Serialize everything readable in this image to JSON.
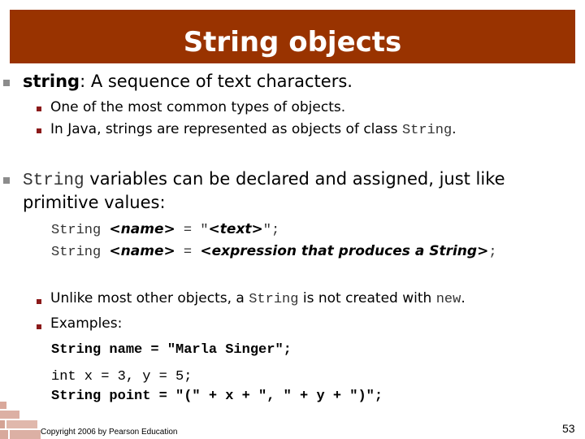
{
  "slide": {
    "title": "String objects",
    "bullet1": {
      "term": "string",
      "rest": ": A sequence of text characters.",
      "sub": [
        "One of the most common types of objects.",
        "In Java, strings are represented as objects of class "
      ],
      "sub2_code": "String",
      "sub2_end": "."
    },
    "bullet2": {
      "code": "String",
      "line1": " variables can be declared and assigned, just like",
      "line2": "primitive values:"
    },
    "syntax": [
      {
        "kw": "String ",
        "name": "<name>",
        "eq": " = \"",
        "val": "<text>",
        "end": "\";"
      },
      {
        "kw": "String ",
        "name": "<name>",
        "eq": " = ",
        "val": "<expression that produces a String>",
        "end": ";"
      }
    ],
    "bullet3": {
      "pre": "Unlike most other objects, a ",
      "code1": "String",
      "mid": " is not created with ",
      "code2": "new",
      "end": "."
    },
    "bullet4": "Examples:",
    "examples": [
      "String name = \"Marla Singer\";",
      "int x = 3, y = 5;",
      "String point = \"(\" + x + \", \" + y + \")\";"
    ],
    "footer": "Copyright 2006 by Pearson Education",
    "page_number": "53"
  },
  "colors": {
    "title_bg": "#993300",
    "bullet_level1": "#8c8c8c",
    "bullet_level2": "#8b1a1a"
  }
}
